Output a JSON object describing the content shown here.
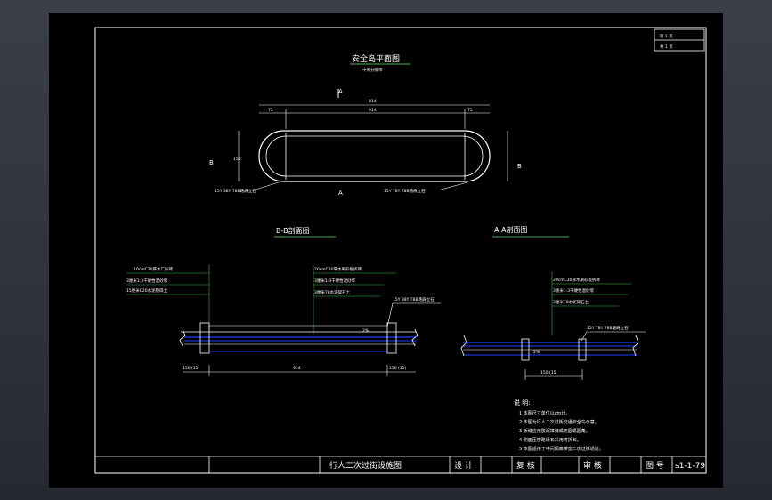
{
  "title_block_top": {
    "sheet_label": "第 1 页",
    "total_label": "共 1 页"
  },
  "plan_view": {
    "title": "安全岛平面图",
    "subtitle": "中央分隔带",
    "overall_dim": "814",
    "left_dim": "75",
    "mid_dim": "914",
    "right_dim": "75",
    "height_dim": "150",
    "section_mark_a_top": "A",
    "section_mark_a_bottom": "A",
    "section_mark_b_left": "B",
    "section_mark_b_right": "B",
    "callout_left": "15Y 38Y 78B路肩立石",
    "callout_right": "15Y 78Y 78B路肩立石"
  },
  "section_bb": {
    "title": "B-B剖面图",
    "layer1": "10cmC30厚水厂拆砖",
    "layer2": "3厘米1:3干硬性混砂浆",
    "layer3": "15厘米C20水泥稳碎土",
    "layer4": "20cmC30厚水刷彩板拆砖",
    "layer5": "3厘米1:3干硬性混砂浆",
    "layer6": "3厘米78水泥碎石土",
    "callout_curb": "15Y 38Y 78B路肩立石",
    "dim_left": "150 (15)",
    "dim_mid": "914",
    "dim_right": "150 (15)",
    "level_mark": "2%"
  },
  "section_aa": {
    "title": "A-A剖面图",
    "layer1": "20cmC30厚水刷彩板拆砖",
    "layer2": "3厘米1:3干硬性混砂浆",
    "layer3": "3厘米78水泥碎石土",
    "callout_curb": "15Y 78Y 78B路肩立石",
    "dim_bottom": "150 (15)",
    "level_mark": "2%"
  },
  "notes": {
    "heading": "说 明:",
    "items": [
      "1 本图尺寸单位以cm计。",
      "2 本图为行人二次过街交通安全岛示意。",
      "3 板缝应用胶泥填缝或用圆弧圆角。",
      "4 侧面压密路缘石采用弯折石。",
      "5 本图适用于中间隔离带宽二次过街通道。"
    ]
  },
  "title_block_bottom": {
    "drawing_name": "行人二次过街设施图",
    "design_label": "设 计",
    "review_label": "复 核",
    "approve_label": "审 核",
    "drawing_no_label": "图 号",
    "drawing_no": "s1-1-79"
  },
  "colors": {
    "background": "#000000",
    "line": "#ffffff",
    "green": "#4caf50",
    "blue": "#1f3fff",
    "frame": "#2b2f36"
  }
}
